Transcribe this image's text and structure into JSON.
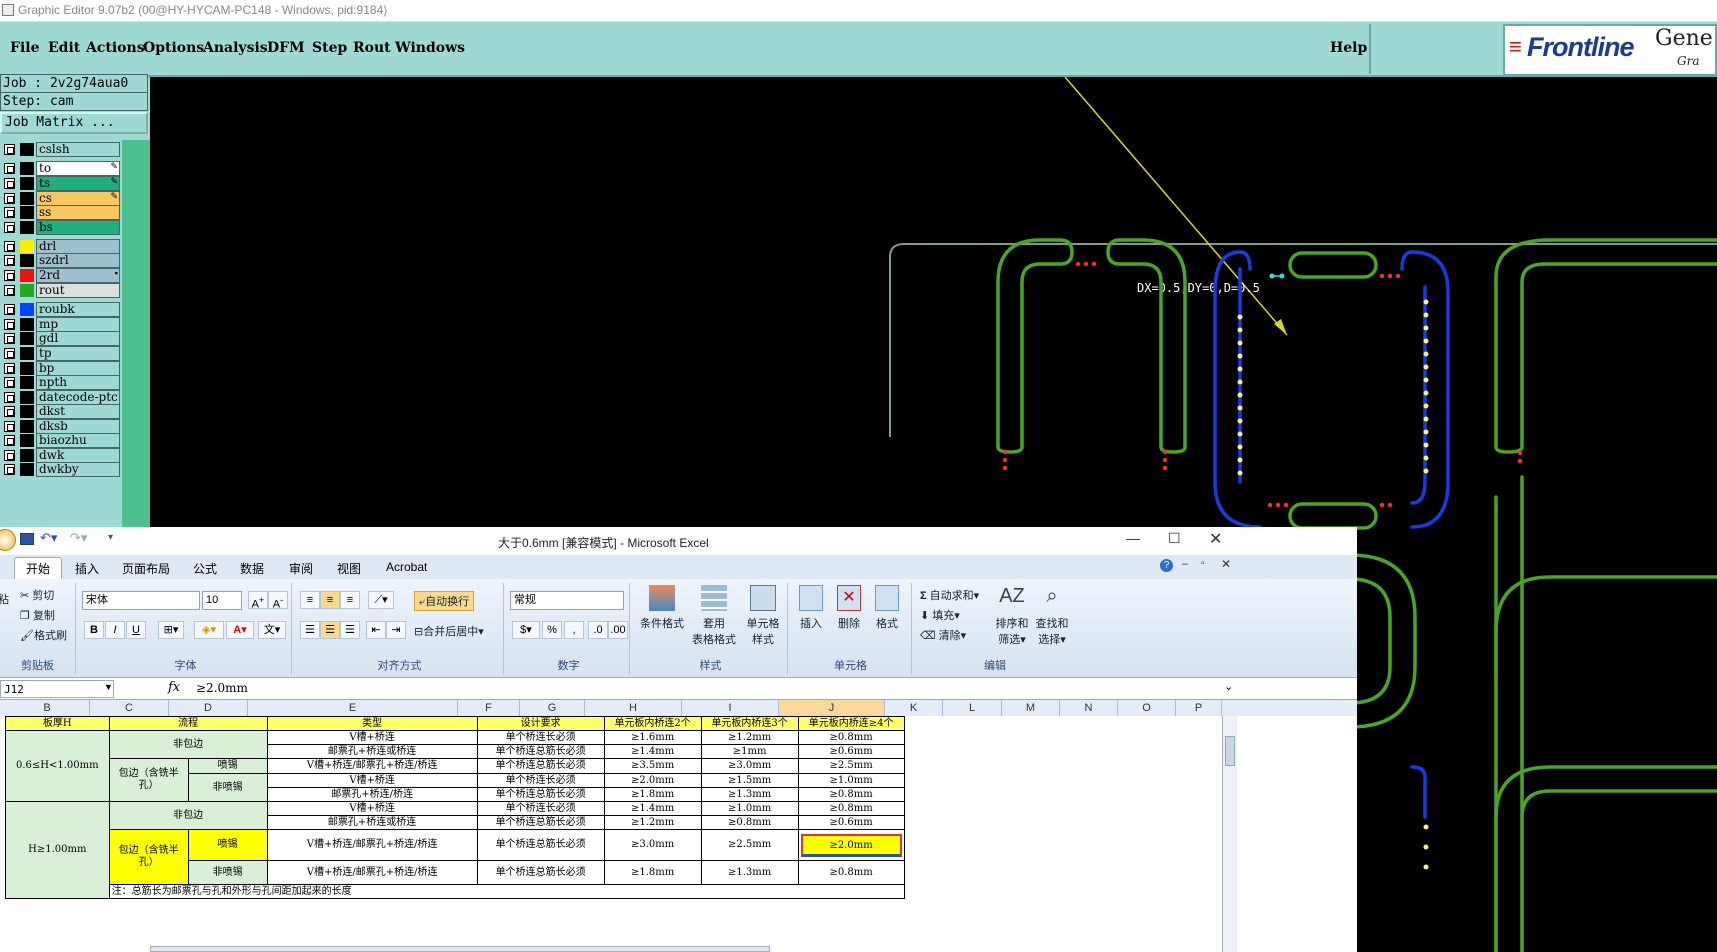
{
  "window_title": "Graphic Editor 9.07b2 (00@HY-HYCAM-PC148 - Windows, pid:9184)",
  "genesis": {
    "menu": [
      "File",
      "Edit",
      "Actions",
      "Options",
      "Analysis",
      "DFM",
      "Step",
      "Rout",
      "Windows"
    ],
    "help": "Help",
    "logo_text": "Frontline",
    "logo_right_top": "Gene",
    "logo_right_bottom": "Gra",
    "job": "Job : 2v2g74aua0",
    "step": "Step: cam",
    "job_matrix": "Job Matrix ...",
    "layers": [
      {
        "name": "cslsh",
        "color": "#9ed9d6",
        "swatch": "#000000",
        "top": 0
      },
      {
        "name": "to",
        "color": "#ffffff",
        "swatch": "#000000",
        "mark": "✎"
      },
      {
        "name": "ts",
        "color": "#1fae7d",
        "swatch": "#000000",
        "mark": "✎"
      },
      {
        "name": "cs",
        "color": "#f6c85f",
        "swatch": "#000000",
        "mark": "✎"
      },
      {
        "name": "ss",
        "color": "#f6c85f",
        "swatch": "#000000"
      },
      {
        "name": "bs",
        "color": "#1fae7d",
        "swatch": "#000000"
      },
      {
        "name": "drl",
        "color": "#9fbfcf",
        "swatch": "#ffee00"
      },
      {
        "name": "szdrl",
        "color": "#9fbfcf",
        "swatch": "#000000"
      },
      {
        "name": "2rd",
        "color": "#9fbfcf",
        "swatch": "#ee1111",
        "mark": "▪"
      },
      {
        "name": "rout",
        "color": "#dedede",
        "swatch": "#22aa22"
      },
      {
        "name": "roubk",
        "color": "#9ed9d6",
        "swatch": "#0044ff"
      },
      {
        "name": "mp",
        "color": "#9ed9d6",
        "swatch": "#000000"
      },
      {
        "name": "gdl",
        "color": "#9ed9d6",
        "swatch": "#000000"
      },
      {
        "name": "tp",
        "color": "#9ed9d6",
        "swatch": "#000000"
      },
      {
        "name": "bp",
        "color": "#9ed9d6",
        "swatch": "#000000"
      },
      {
        "name": "npth",
        "color": "#9ed9d6",
        "swatch": "#000000"
      },
      {
        "name": "datecode-ptc",
        "color": "#9ed9d6",
        "swatch": "#000000"
      },
      {
        "name": "dkst",
        "color": "#9ed9d6",
        "swatch": "#000000"
      },
      {
        "name": "dksb",
        "color": "#9ed9d6",
        "swatch": "#000000"
      },
      {
        "name": "biaozhu",
        "color": "#9ed9d6",
        "swatch": "#000000"
      },
      {
        "name": "dwk",
        "color": "#9ed9d6",
        "swatch": "#000000"
      },
      {
        "name": "dwkby",
        "color": "#9ed9d6",
        "swatch": "#000000"
      }
    ],
    "canvas_readout": "DX=0.5,DY=0,D=0.5"
  },
  "excel": {
    "title": "大于0.6mm [兼容模式] - Microsoft Excel",
    "tabs": [
      "开始",
      "插入",
      "页面布局",
      "公式",
      "数据",
      "审阅",
      "视图",
      "Acrobat"
    ],
    "active_tab": "开始",
    "clipboard": {
      "cut": "剪切",
      "copy": "复制",
      "format_painter": "格式刷",
      "paste": "粘",
      "group": "剪贴板"
    },
    "font": {
      "name": "宋体",
      "size": "10",
      "group": "字体"
    },
    "alignment": {
      "wrap": "自动换行",
      "merge": "合并后居中",
      "group": "对齐方式"
    },
    "number": {
      "format": "常规",
      "group": "数字"
    },
    "styles": {
      "conditional": "条件格式",
      "table_1": "套用",
      "table_2": "表格格式",
      "cell_1": "单元格",
      "cell_2": "样式",
      "group": "样式"
    },
    "cells": {
      "insert": "插入",
      "delete": "删除",
      "format": "格式",
      "group": "单元格"
    },
    "editing": {
      "autosum": "自动求和",
      "fill": "填充",
      "clear": "清除",
      "sort_1": "排序和",
      "sort_2": "筛选",
      "find_1": "查找和",
      "find_2": "选择",
      "group": "编辑"
    },
    "name_box": "J12",
    "formula": "≥2.0mm",
    "columns": [
      "B",
      "C",
      "D",
      "E",
      "F",
      "G",
      "H",
      "I",
      "J",
      "K",
      "L",
      "M",
      "N",
      "O",
      "P"
    ],
    "header_row": [
      "板厚H",
      "流程",
      "类型",
      "设计要求",
      "单元板内桥连2个",
      "单元板内桥连3个",
      "单元板内桥连≥4个"
    ],
    "groups": {
      "g1": "0.6≤H<1.00mm",
      "g2": "H≥1.00mm",
      "nowrap": "非包边",
      "wrap": "包边（含铣半孔）",
      "spray": "喷锡",
      "nospray": "非喷锡"
    },
    "rows": [
      [
        "V槽+桥连",
        "单个桥连长必须",
        "≥1.6mm",
        "≥1.2mm",
        "≥0.8mm"
      ],
      [
        "邮票孔+桥连或桥连",
        "单个桥连总筋长必须",
        "≥1.4mm",
        "≥1mm",
        "≥0.6mm"
      ],
      [
        "V槽+桥连/邮票孔+桥连/桥连",
        "单个桥连总筋长必须",
        "≥3.5mm",
        "≥3.0mm",
        "≥2.5mm"
      ],
      [
        "V槽+桥连",
        "单个桥连长必须",
        "≥2.0mm",
        "≥1.5mm",
        "≥1.0mm"
      ],
      [
        "邮票孔+桥连/桥连",
        "单个桥连总筋长必须",
        "≥1.8mm",
        "≥1.3mm",
        "≥0.8mm"
      ],
      [
        "V槽+桥连",
        "单个桥连长必须",
        "≥1.4mm",
        "≥1.0mm",
        "≥0.8mm"
      ],
      [
        "邮票孔+桥连或桥连",
        "单个桥连总筋长必须",
        "≥1.2mm",
        "≥0.8mm",
        "≥0.6mm"
      ],
      [
        "V槽+桥连/邮票孔+桥连/桥连",
        "单个桥连总筋长必须",
        "≥3.0mm",
        "≥2.5mm",
        "≥2.0mm"
      ],
      [
        "V槽+桥连/邮票孔+桥连/桥连",
        "单个桥连总筋长必须",
        "≥1.8mm",
        "≥1.3mm",
        "≥0.8mm"
      ]
    ],
    "note": "注：总筋长为邮票孔与孔和外形与孔间距加起来的长度"
  }
}
